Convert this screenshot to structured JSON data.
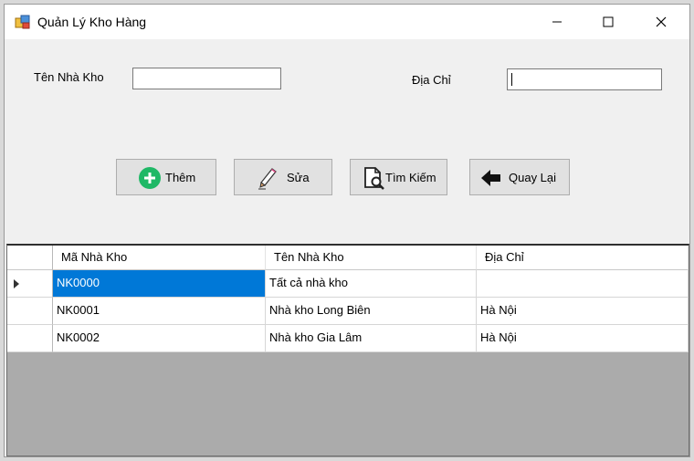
{
  "window": {
    "title": "Quản Lý Kho Hàng",
    "minimize_icon": "minimize-icon",
    "maximize_icon": "maximize-icon",
    "close_icon": "close-icon"
  },
  "form": {
    "name_label": "Tên Nhà Kho",
    "name_value": "",
    "address_label": "Địa Chỉ",
    "address_value": ""
  },
  "buttons": {
    "add": {
      "label": "Thêm",
      "icon": "plus-circle-icon",
      "color": "#1fb866"
    },
    "edit": {
      "label": "Sửa",
      "icon": "pencil-icon"
    },
    "search": {
      "label": "Tìm Kiếm",
      "icon": "document-search-icon"
    },
    "back": {
      "label": "Quay Lại",
      "icon": "arrow-left-icon"
    }
  },
  "grid": {
    "columns": [
      "Mã Nhà Kho",
      "Tên Nhà Kho",
      "Địa Chỉ"
    ],
    "rows": [
      [
        "NK0000",
        "Tất cả nhà kho",
        ""
      ],
      [
        "NK0001",
        "Nhà kho Long Biên",
        "Hà Nội"
      ],
      [
        "NK0002",
        "Nhà kho Gia Lâm",
        "Hà Nội"
      ]
    ],
    "selected_row": 0,
    "selection_color": "#0078d7"
  }
}
